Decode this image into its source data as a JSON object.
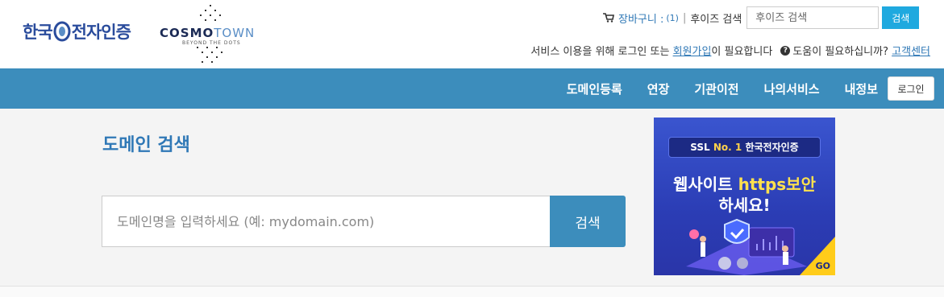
{
  "header": {
    "logo_korea": {
      "part1": "한국",
      "part2": "전자인증"
    },
    "logo_cosmotown": {
      "cosmo": "COSMO",
      "town": "TOWN",
      "tagline": "BEYOND THE DOTS"
    },
    "cart": {
      "label": "장바구니 :",
      "count": "(1)"
    },
    "separator": "|",
    "whois": {
      "label": "후이즈 검색",
      "placeholder": "후이즈 검색",
      "button": "검색"
    },
    "notice": {
      "text_before": "서비스 이용을 위해 로그인 또는",
      "signup_link": "회원가입",
      "text_after": "이 필요합니다",
      "help_text": "도움이 필요하십니까?",
      "support_link": "고객센터"
    }
  },
  "nav": {
    "items": [
      "도메인등록",
      "연장",
      "기관이전",
      "나의서비스",
      "내정보"
    ],
    "login_button": "로그인",
    "color": "#3c8dbc"
  },
  "main": {
    "title": "도메인 검색",
    "search_placeholder": "도메인명을 입력하세요 (예: mydomain.com)",
    "search_button": "검색"
  },
  "banner": {
    "pill_prefix": "SSL",
    "pill_no1": "No. 1",
    "pill_suffix": "한국전자인증",
    "headline_part1": "웹사이트",
    "headline_highlight": "https",
    "headline_part2": "보안",
    "headline_line2": "하세요!",
    "go": "GO"
  },
  "colors": {
    "link": "#2f78b6",
    "whois_button": "#1fa9df",
    "title": "#2f78b6"
  }
}
